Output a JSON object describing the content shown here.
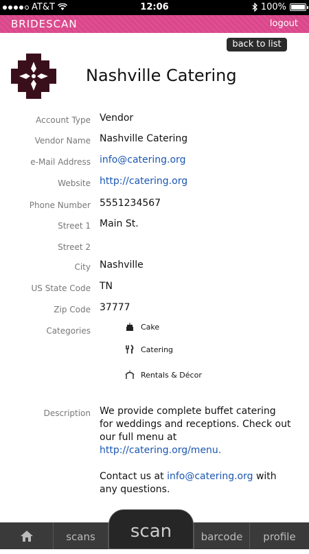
{
  "status": {
    "carrier": "AT&T",
    "time": "12:06",
    "battery": "100%"
  },
  "header": {
    "brand": "BRIDESCAN",
    "logout": "logout"
  },
  "back_button": "back to list",
  "title": "Nashville Catering",
  "fields": {
    "account_type": {
      "label": "Account Type",
      "value": "Vendor"
    },
    "vendor_name": {
      "label": "Vendor Name",
      "value": "Nashville Catering"
    },
    "email": {
      "label": "e-Mail Address",
      "value": "info@catering.org"
    },
    "website": {
      "label": "Website",
      "value": "http://catering.org"
    },
    "phone": {
      "label": "Phone Number",
      "value": "5551234567"
    },
    "street1": {
      "label": "Street 1",
      "value": "Main St."
    },
    "street2": {
      "label": "Street 2",
      "value": ""
    },
    "city": {
      "label": "City",
      "value": "Nashville"
    },
    "state": {
      "label": "US State Code",
      "value": "TN"
    },
    "zip": {
      "label": "Zip Code",
      "value": "37777"
    },
    "categories_label": "Categories",
    "description_label": "Description"
  },
  "categories": [
    {
      "name": "Cake",
      "icon": "cake-icon"
    },
    {
      "name": "Catering",
      "icon": "fork-knife-icon"
    },
    {
      "name": "Rentals & Décor",
      "icon": "tent-icon"
    }
  ],
  "description": {
    "line1": "We provide complete buffet catering for weddings and receptions. Check out our full menu at",
    "menu_link": "http://catering.org/menu.",
    "contact_prefix": "Contact us at",
    "contact_email": "info@catering.org",
    "contact_suffix": "with any questions."
  },
  "tabs": {
    "scans": "scans",
    "scan": "scan",
    "barcode": "barcode",
    "profile": "profile"
  },
  "colors": {
    "brand_pink": "#df4f92",
    "link_blue": "#1a56b0",
    "tabbar": "#3a3a3a"
  }
}
